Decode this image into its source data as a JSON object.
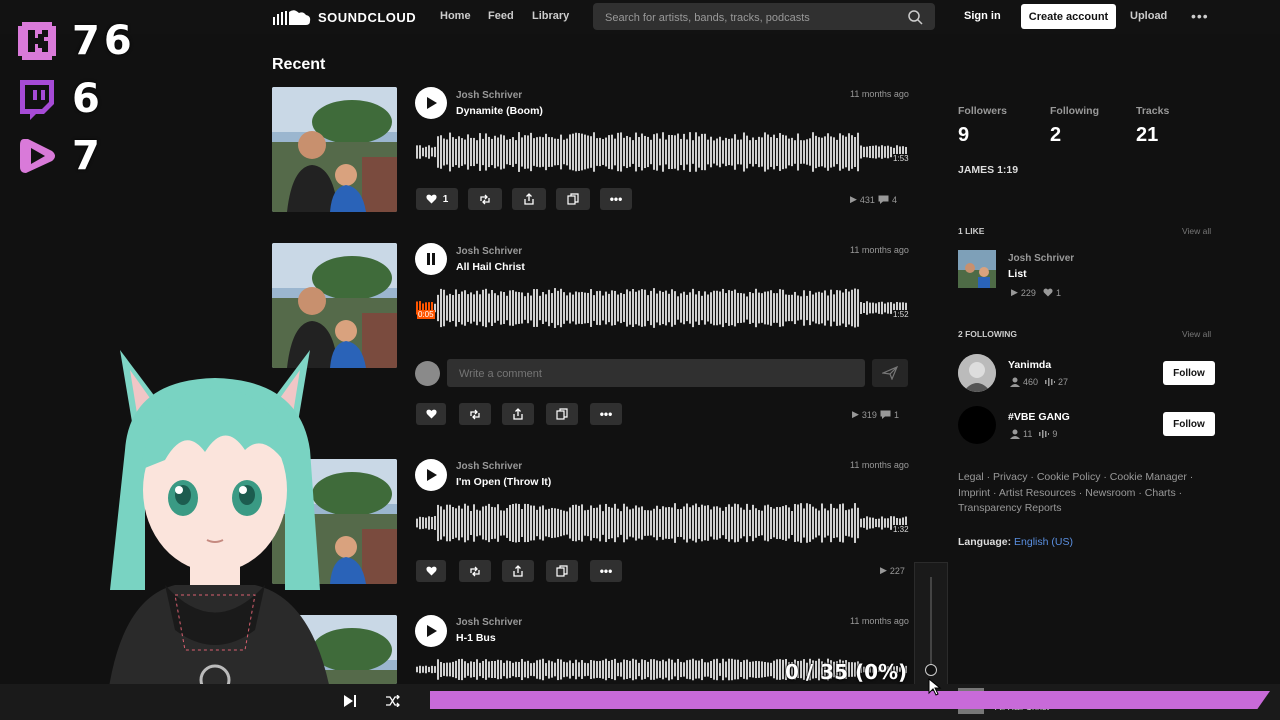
{
  "header": {
    "brand": "SOUNDCLOUD",
    "nav": [
      "Home",
      "Feed",
      "Library"
    ],
    "search_placeholder": "Search for artists, bands, tracks, podcasts",
    "signin": "Sign in",
    "create_account": "Create account",
    "upload": "Upload",
    "more": "•••"
  },
  "overlay_stats": [
    {
      "icon": "kick-icon",
      "value": "76",
      "color": "#d97ad9"
    },
    {
      "icon": "twitch-icon",
      "value": "6",
      "color": "#a64bd6"
    },
    {
      "icon": "rumble-icon",
      "value": "7",
      "color": "#d97ad9"
    }
  ],
  "recent": {
    "title": "Recent",
    "tracks": [
      {
        "artist": "Josh Schriver",
        "title": "Dynamite (Boom)",
        "age": "11 months ago",
        "duration": "1:53",
        "likes": "1",
        "plays": "431",
        "comments": "4",
        "state": "paused"
      },
      {
        "artist": "Josh Schriver",
        "title": "All Hail Christ",
        "age": "11 months ago",
        "duration": "1:52",
        "elapsed": "0:05",
        "plays": "319",
        "comments": "1",
        "state": "playing",
        "comment_placeholder": "Write a comment"
      },
      {
        "artist": "Josh Schriver",
        "title": "I'm Open (Throw It)",
        "age": "11 months ago",
        "duration": "1:32",
        "plays": "227",
        "state": "paused"
      },
      {
        "artist": "Josh Schriver",
        "title": "H-1 Bus",
        "age": "11 months ago",
        "state": "paused"
      }
    ]
  },
  "sidebar": {
    "stats": [
      {
        "label": "Followers",
        "value": "9"
      },
      {
        "label": "Following",
        "value": "2"
      },
      {
        "label": "Tracks",
        "value": "21"
      }
    ],
    "bio": "JAMES 1:19",
    "likes": {
      "heading": "1 LIKE",
      "view_all": "View all",
      "item": {
        "artist": "Josh Schriver",
        "title": "List",
        "plays": "229",
        "likes": "1"
      }
    },
    "following": {
      "heading": "2 FOLLOWING",
      "view_all": "View all",
      "items": [
        {
          "name": "Yanimda",
          "followers": "460",
          "tracks": "27",
          "button": "Follow"
        },
        {
          "name": "#VBE GANG",
          "followers": "11",
          "tracks": "9",
          "button": "Follow"
        }
      ]
    },
    "footer_links": [
      "Legal",
      "Privacy",
      "Cookie Policy",
      "Cookie Manager",
      "Imprint",
      "Artist Resources",
      "Newsroom",
      "Charts",
      "Transparency Reports"
    ],
    "language_label": "Language:",
    "language_value": "English (US)"
  },
  "player": {
    "counter": "0 / 35 (0%)",
    "now_playing": "All Hail Christ",
    "progress_fraction": 0.0
  },
  "colors": {
    "accent_orange": "#ff5500",
    "overlay_pink": "#c86ad9",
    "background": "#111111"
  }
}
